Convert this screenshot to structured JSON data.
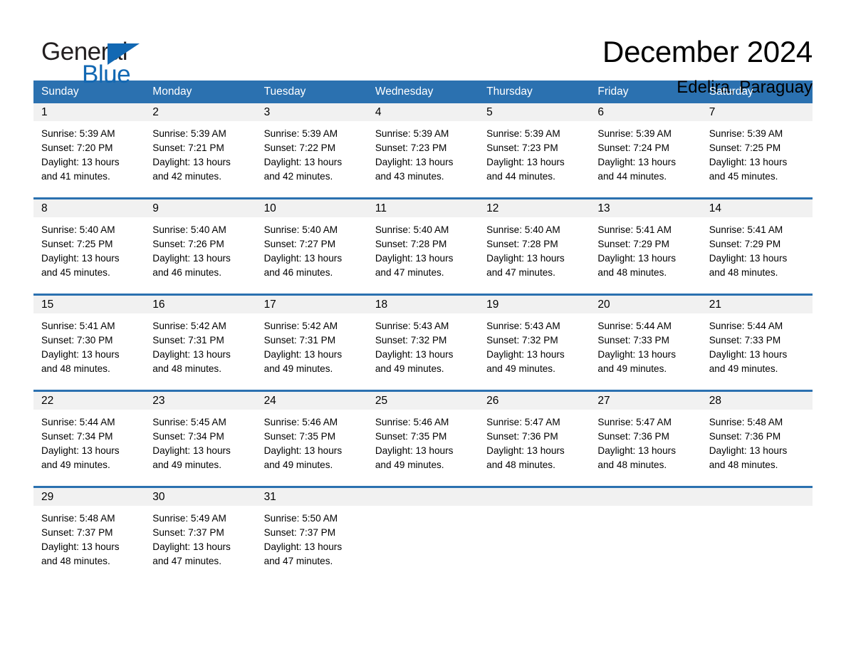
{
  "brand": {
    "name_part1": "General",
    "name_part2": "Blue",
    "accent_color": "#1268b3"
  },
  "header": {
    "title": "December 2024",
    "location": "Edelira, Paraguay"
  },
  "theme": {
    "header_blue": "#2b71b0",
    "date_band_gray": "#f1f1f1",
    "text_black": "#000000"
  },
  "weekdays": [
    "Sunday",
    "Monday",
    "Tuesday",
    "Wednesday",
    "Thursday",
    "Friday",
    "Saturday"
  ],
  "weeks": [
    [
      {
        "day": "1",
        "sunrise": "Sunrise: 5:39 AM",
        "sunset": "Sunset: 7:20 PM",
        "daylight1": "Daylight: 13 hours",
        "daylight2": "and 41 minutes."
      },
      {
        "day": "2",
        "sunrise": "Sunrise: 5:39 AM",
        "sunset": "Sunset: 7:21 PM",
        "daylight1": "Daylight: 13 hours",
        "daylight2": "and 42 minutes."
      },
      {
        "day": "3",
        "sunrise": "Sunrise: 5:39 AM",
        "sunset": "Sunset: 7:22 PM",
        "daylight1": "Daylight: 13 hours",
        "daylight2": "and 42 minutes."
      },
      {
        "day": "4",
        "sunrise": "Sunrise: 5:39 AM",
        "sunset": "Sunset: 7:23 PM",
        "daylight1": "Daylight: 13 hours",
        "daylight2": "and 43 minutes."
      },
      {
        "day": "5",
        "sunrise": "Sunrise: 5:39 AM",
        "sunset": "Sunset: 7:23 PM",
        "daylight1": "Daylight: 13 hours",
        "daylight2": "and 44 minutes."
      },
      {
        "day": "6",
        "sunrise": "Sunrise: 5:39 AM",
        "sunset": "Sunset: 7:24 PM",
        "daylight1": "Daylight: 13 hours",
        "daylight2": "and 44 minutes."
      },
      {
        "day": "7",
        "sunrise": "Sunrise: 5:39 AM",
        "sunset": "Sunset: 7:25 PM",
        "daylight1": "Daylight: 13 hours",
        "daylight2": "and 45 minutes."
      }
    ],
    [
      {
        "day": "8",
        "sunrise": "Sunrise: 5:40 AM",
        "sunset": "Sunset: 7:25 PM",
        "daylight1": "Daylight: 13 hours",
        "daylight2": "and 45 minutes."
      },
      {
        "day": "9",
        "sunrise": "Sunrise: 5:40 AM",
        "sunset": "Sunset: 7:26 PM",
        "daylight1": "Daylight: 13 hours",
        "daylight2": "and 46 minutes."
      },
      {
        "day": "10",
        "sunrise": "Sunrise: 5:40 AM",
        "sunset": "Sunset: 7:27 PM",
        "daylight1": "Daylight: 13 hours",
        "daylight2": "and 46 minutes."
      },
      {
        "day": "11",
        "sunrise": "Sunrise: 5:40 AM",
        "sunset": "Sunset: 7:28 PM",
        "daylight1": "Daylight: 13 hours",
        "daylight2": "and 47 minutes."
      },
      {
        "day": "12",
        "sunrise": "Sunrise: 5:40 AM",
        "sunset": "Sunset: 7:28 PM",
        "daylight1": "Daylight: 13 hours",
        "daylight2": "and 47 minutes."
      },
      {
        "day": "13",
        "sunrise": "Sunrise: 5:41 AM",
        "sunset": "Sunset: 7:29 PM",
        "daylight1": "Daylight: 13 hours",
        "daylight2": "and 48 minutes."
      },
      {
        "day": "14",
        "sunrise": "Sunrise: 5:41 AM",
        "sunset": "Sunset: 7:29 PM",
        "daylight1": "Daylight: 13 hours",
        "daylight2": "and 48 minutes."
      }
    ],
    [
      {
        "day": "15",
        "sunrise": "Sunrise: 5:41 AM",
        "sunset": "Sunset: 7:30 PM",
        "daylight1": "Daylight: 13 hours",
        "daylight2": "and 48 minutes."
      },
      {
        "day": "16",
        "sunrise": "Sunrise: 5:42 AM",
        "sunset": "Sunset: 7:31 PM",
        "daylight1": "Daylight: 13 hours",
        "daylight2": "and 48 minutes."
      },
      {
        "day": "17",
        "sunrise": "Sunrise: 5:42 AM",
        "sunset": "Sunset: 7:31 PM",
        "daylight1": "Daylight: 13 hours",
        "daylight2": "and 49 minutes."
      },
      {
        "day": "18",
        "sunrise": "Sunrise: 5:43 AM",
        "sunset": "Sunset: 7:32 PM",
        "daylight1": "Daylight: 13 hours",
        "daylight2": "and 49 minutes."
      },
      {
        "day": "19",
        "sunrise": "Sunrise: 5:43 AM",
        "sunset": "Sunset: 7:32 PM",
        "daylight1": "Daylight: 13 hours",
        "daylight2": "and 49 minutes."
      },
      {
        "day": "20",
        "sunrise": "Sunrise: 5:44 AM",
        "sunset": "Sunset: 7:33 PM",
        "daylight1": "Daylight: 13 hours",
        "daylight2": "and 49 minutes."
      },
      {
        "day": "21",
        "sunrise": "Sunrise: 5:44 AM",
        "sunset": "Sunset: 7:33 PM",
        "daylight1": "Daylight: 13 hours",
        "daylight2": "and 49 minutes."
      }
    ],
    [
      {
        "day": "22",
        "sunrise": "Sunrise: 5:44 AM",
        "sunset": "Sunset: 7:34 PM",
        "daylight1": "Daylight: 13 hours",
        "daylight2": "and 49 minutes."
      },
      {
        "day": "23",
        "sunrise": "Sunrise: 5:45 AM",
        "sunset": "Sunset: 7:34 PM",
        "daylight1": "Daylight: 13 hours",
        "daylight2": "and 49 minutes."
      },
      {
        "day": "24",
        "sunrise": "Sunrise: 5:46 AM",
        "sunset": "Sunset: 7:35 PM",
        "daylight1": "Daylight: 13 hours",
        "daylight2": "and 49 minutes."
      },
      {
        "day": "25",
        "sunrise": "Sunrise: 5:46 AM",
        "sunset": "Sunset: 7:35 PM",
        "daylight1": "Daylight: 13 hours",
        "daylight2": "and 49 minutes."
      },
      {
        "day": "26",
        "sunrise": "Sunrise: 5:47 AM",
        "sunset": "Sunset: 7:36 PM",
        "daylight1": "Daylight: 13 hours",
        "daylight2": "and 48 minutes."
      },
      {
        "day": "27",
        "sunrise": "Sunrise: 5:47 AM",
        "sunset": "Sunset: 7:36 PM",
        "daylight1": "Daylight: 13 hours",
        "daylight2": "and 48 minutes."
      },
      {
        "day": "28",
        "sunrise": "Sunrise: 5:48 AM",
        "sunset": "Sunset: 7:36 PM",
        "daylight1": "Daylight: 13 hours",
        "daylight2": "and 48 minutes."
      }
    ],
    [
      {
        "day": "29",
        "sunrise": "Sunrise: 5:48 AM",
        "sunset": "Sunset: 7:37 PM",
        "daylight1": "Daylight: 13 hours",
        "daylight2": "and 48 minutes."
      },
      {
        "day": "30",
        "sunrise": "Sunrise: 5:49 AM",
        "sunset": "Sunset: 7:37 PM",
        "daylight1": "Daylight: 13 hours",
        "daylight2": "and 47 minutes."
      },
      {
        "day": "31",
        "sunrise": "Sunrise: 5:50 AM",
        "sunset": "Sunset: 7:37 PM",
        "daylight1": "Daylight: 13 hours",
        "daylight2": "and 47 minutes."
      },
      {
        "day": "",
        "sunrise": "",
        "sunset": "",
        "daylight1": "",
        "daylight2": ""
      },
      {
        "day": "",
        "sunrise": "",
        "sunset": "",
        "daylight1": "",
        "daylight2": ""
      },
      {
        "day": "",
        "sunrise": "",
        "sunset": "",
        "daylight1": "",
        "daylight2": ""
      },
      {
        "day": "",
        "sunrise": "",
        "sunset": "",
        "daylight1": "",
        "daylight2": ""
      }
    ]
  ]
}
